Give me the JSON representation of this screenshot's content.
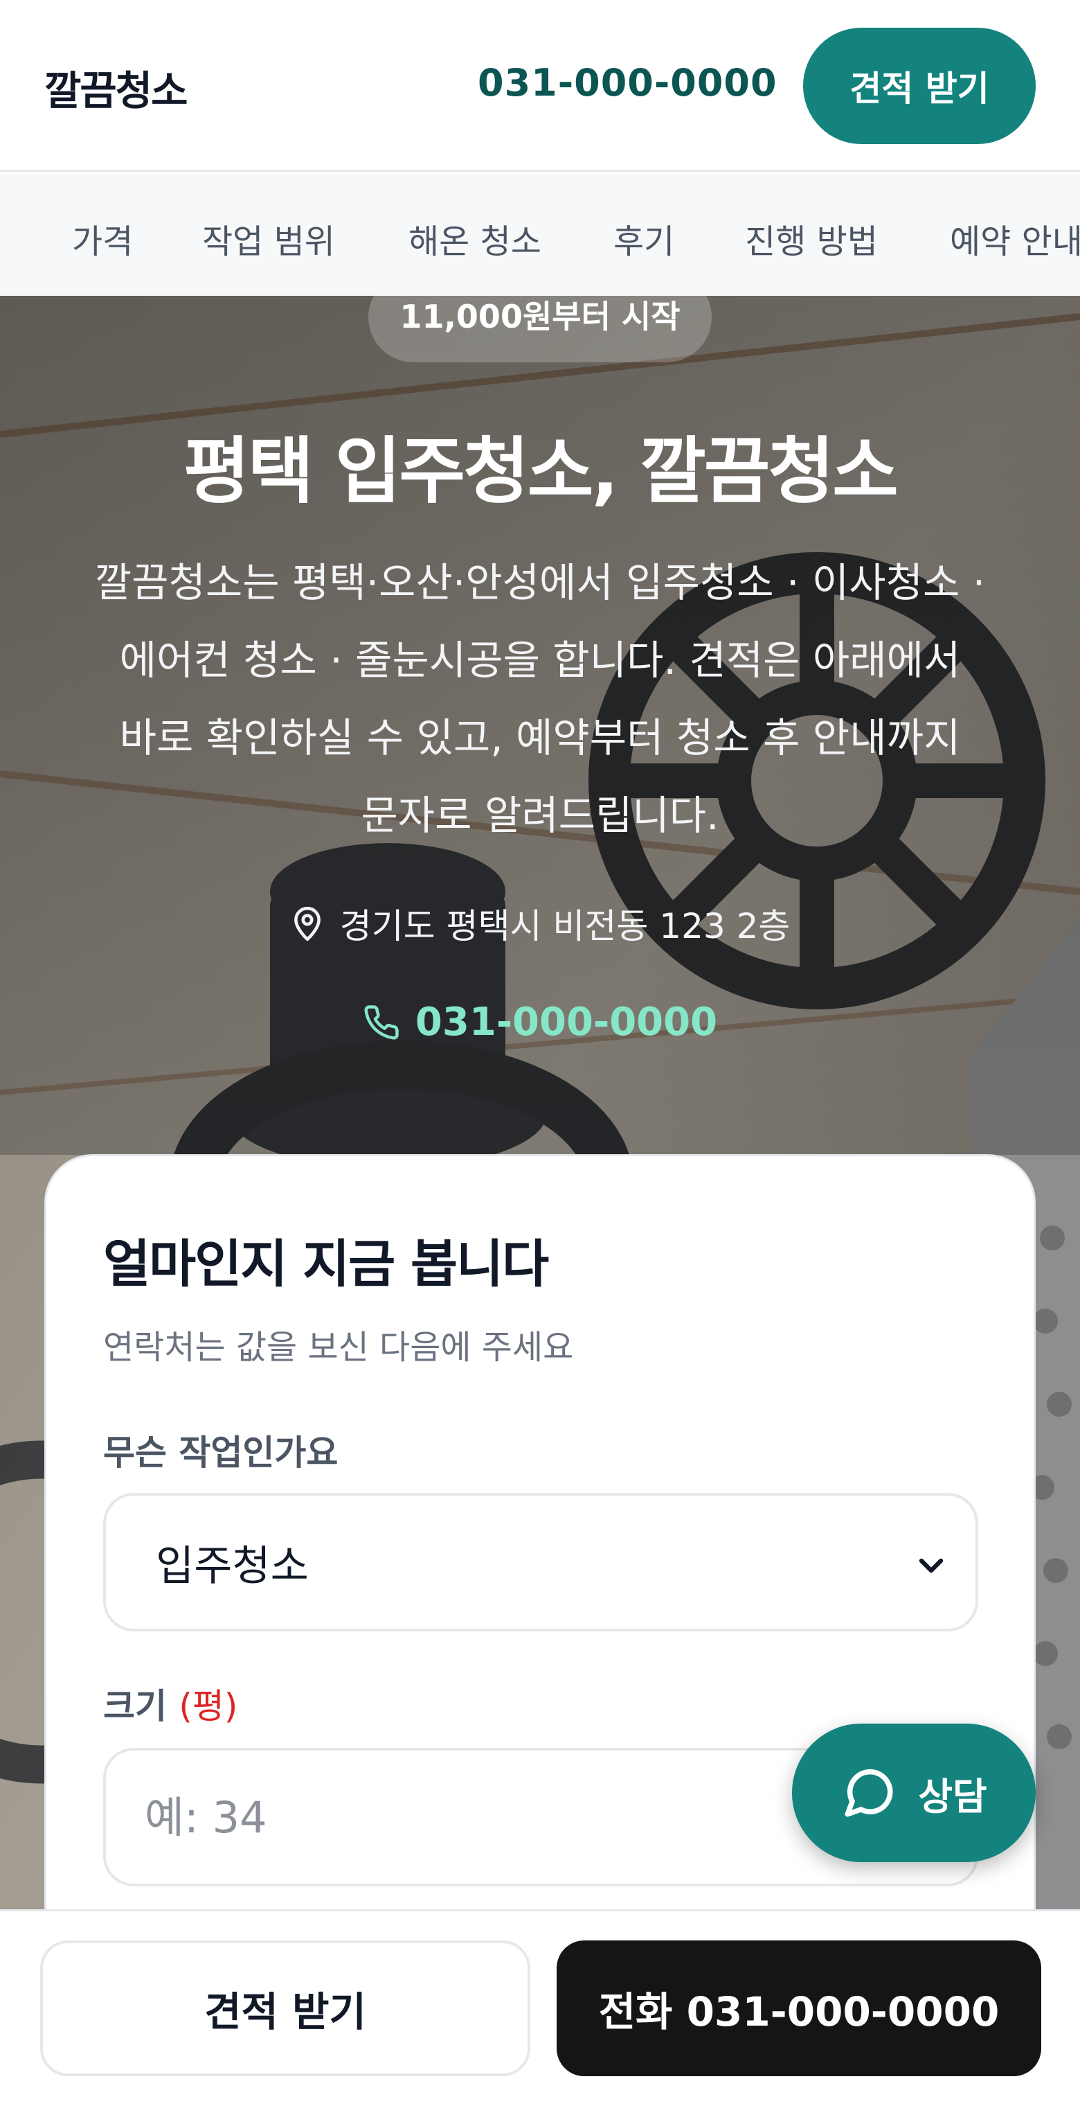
{
  "header": {
    "brand": "깔끔청소",
    "phone": "031-000-0000",
    "cta_label": "견적 받기"
  },
  "tabs": [
    "가격",
    "작업 범위",
    "해온 청소",
    "후기",
    "진행 방법",
    "예약 안내"
  ],
  "hero": {
    "price_badge": "11,000원부터 시작",
    "title": "평택 입주청소, 깔끔청소",
    "description_lines": [
      "깔끔청소는 평택·오산·안성에서 입주청소 · 이사청소 ·",
      "에어컨 청소 · 줄눈시공을 합니다. 견적은 아래에서",
      "바로 확인하실 수 있고, 예약부터 청소 후 안내까지",
      "문자로 알려드립니다."
    ],
    "address": "경기도 평택시 비전동 123 2층",
    "phone": "031-000-0000"
  },
  "quote_card": {
    "title": "얼마인지 지금 봅니다",
    "subtitle": "연락처는 값을 보신 다음에 주세요",
    "service_label": "무슨 작업인가요",
    "service_selected": "입주청소",
    "size_label": "크기",
    "size_unit": "(평)",
    "size_placeholder": "예: 34"
  },
  "chat_fab": {
    "label": "상담"
  },
  "bottom_bar": {
    "quote_label": "견적 받기",
    "call_label": "전화 031-000-0000"
  },
  "colors": {
    "brand_teal": "#14837d",
    "phone_dark_teal": "#0b5553",
    "hero_phone_mint": "#86e6c8",
    "unit_red": "#dc2626",
    "call_button_dark": "#151517"
  }
}
